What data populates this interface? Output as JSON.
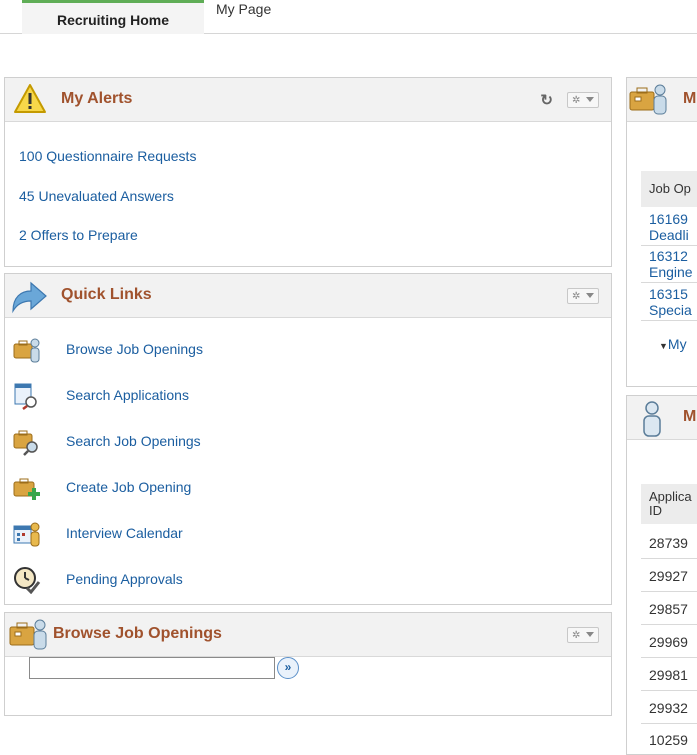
{
  "tabs": {
    "active": "Recruiting Home",
    "inactive": "My Page"
  },
  "alerts": {
    "title": "My Alerts",
    "items": [
      {
        "label": "100 Questionnaire Requests"
      },
      {
        "label": "45 Unevaluated Answers"
      },
      {
        "label": "2 Offers to Prepare"
      }
    ]
  },
  "quick_links": {
    "title": "Quick Links",
    "items": [
      {
        "label": "Browse Job Openings",
        "icon": "briefcase-person-icon"
      },
      {
        "label": "Search Applications",
        "icon": "document-magnifier-icon"
      },
      {
        "label": "Search Job Openings",
        "icon": "briefcase-search-icon"
      },
      {
        "label": "Create Job Opening",
        "icon": "briefcase-plus-icon"
      },
      {
        "label": "Interview Calendar",
        "icon": "calendar-person-icon"
      },
      {
        "label": "Pending Approvals",
        "icon": "clock-check-icon"
      }
    ]
  },
  "browse": {
    "title": "Browse Job Openings",
    "input_value": "",
    "go_label": "»"
  },
  "right_top": {
    "title_partial": "M",
    "column_header": "Job Op",
    "rows": [
      {
        "line1": "16169",
        "line2": "Deadli"
      },
      {
        "line1": "16312",
        "line2": "Engine"
      },
      {
        "line1": "16315",
        "line2": "Specia"
      }
    ],
    "more_link": "My"
  },
  "right_bottom": {
    "title_partial": "M",
    "column_header_line1": "Applica",
    "column_header_line2": "ID",
    "rows": [
      "28739",
      "29927",
      "29857",
      "29969",
      "29981",
      "29932",
      "10259"
    ]
  },
  "colors": {
    "title": "#a0522d",
    "link": "#1b5ea0",
    "active_tab_accent": "#5fad56"
  }
}
